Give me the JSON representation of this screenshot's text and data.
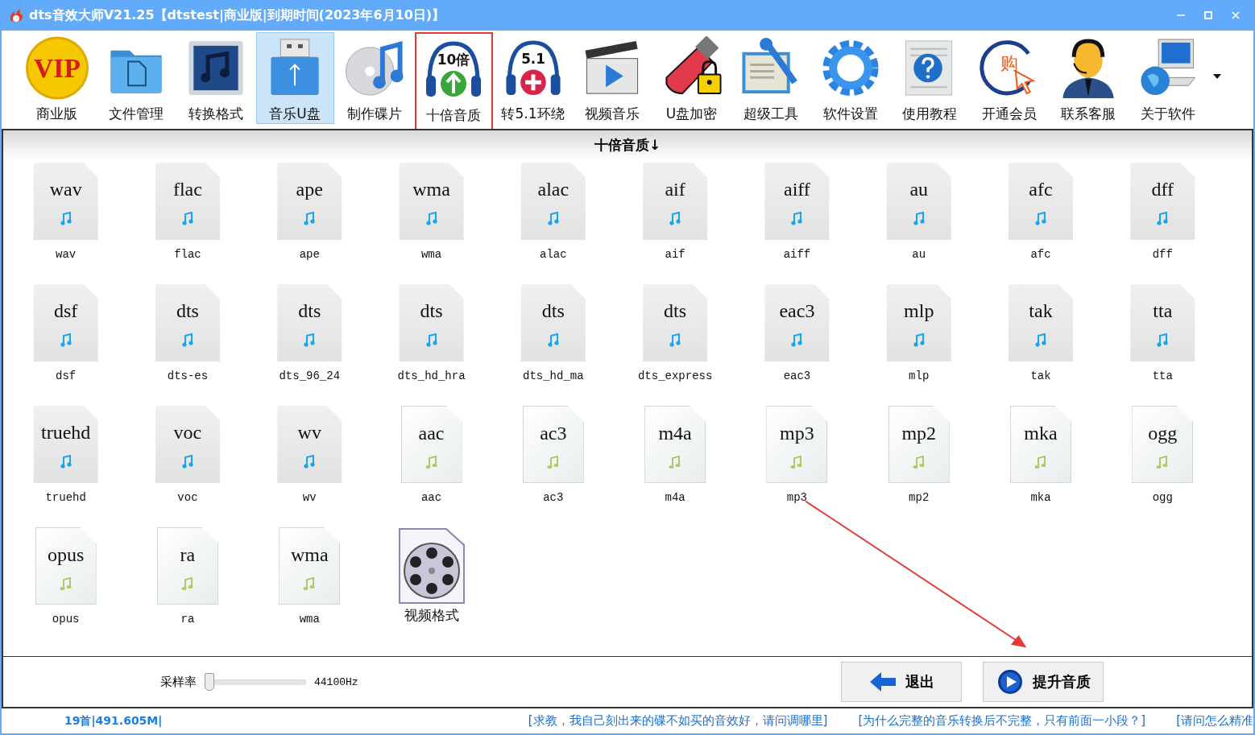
{
  "window": {
    "title": "dts音效大师V21.25【dtstest|商业版|到期时间(2023年6月10日)】"
  },
  "toolbar": [
    {
      "label": "商业版",
      "kind": "vip",
      "icon_text": "VIP",
      "selected": false,
      "outlined": false
    },
    {
      "label": "文件管理",
      "kind": "folder",
      "selected": false,
      "outlined": false
    },
    {
      "label": "转换格式",
      "kind": "note",
      "selected": false,
      "outlined": false
    },
    {
      "label": "音乐U盘",
      "kind": "usb",
      "selected": true,
      "outlined": false
    },
    {
      "label": "制作碟片",
      "kind": "disc",
      "selected": false,
      "outlined": false
    },
    {
      "label": "十倍音质",
      "kind": "headphone_up",
      "icon_text": "10倍",
      "selected": false,
      "outlined": true
    },
    {
      "label": "转5.1环绕",
      "kind": "headphone_plus",
      "icon_text": "5.1",
      "selected": false,
      "outlined": false
    },
    {
      "label": "视频音乐",
      "kind": "clapper",
      "selected": false,
      "outlined": false
    },
    {
      "label": "U盘加密",
      "kind": "lock",
      "selected": false,
      "outlined": false
    },
    {
      "label": "超级工具",
      "kind": "wrench",
      "selected": false,
      "outlined": false
    },
    {
      "label": "软件设置",
      "kind": "gear",
      "selected": false,
      "outlined": false
    },
    {
      "label": "使用教程",
      "kind": "help",
      "selected": false,
      "outlined": false
    },
    {
      "label": "开通会员",
      "kind": "buy",
      "icon_text": "购",
      "selected": false,
      "outlined": false
    },
    {
      "label": "联系客服",
      "kind": "agent",
      "selected": false,
      "outlined": false
    },
    {
      "label": "关于软件",
      "kind": "computer",
      "selected": false,
      "outlined": false
    }
  ],
  "panel": {
    "heading": "十倍音质↓",
    "files": [
      {
        "kind": "blue",
        "ext": "wav",
        "label": "wav"
      },
      {
        "kind": "blue",
        "ext": "flac",
        "label": "flac"
      },
      {
        "kind": "blue",
        "ext": "ape",
        "label": "ape"
      },
      {
        "kind": "blue",
        "ext": "wma",
        "label": "wma"
      },
      {
        "kind": "blue",
        "ext": "alac",
        "label": "alac"
      },
      {
        "kind": "blue",
        "ext": "aif",
        "label": "aif"
      },
      {
        "kind": "blue",
        "ext": "aiff",
        "label": "aiff"
      },
      {
        "kind": "blue",
        "ext": "au",
        "label": "au"
      },
      {
        "kind": "blue",
        "ext": "afc",
        "label": "afc"
      },
      {
        "kind": "blue",
        "ext": "dff",
        "label": "dff"
      },
      {
        "kind": "blue",
        "ext": "dsf",
        "label": "dsf"
      },
      {
        "kind": "blue",
        "ext": "dts",
        "label": "dts-es"
      },
      {
        "kind": "blue",
        "ext": "dts",
        "label": "dts_96_24"
      },
      {
        "kind": "blue",
        "ext": "dts",
        "label": "dts_hd_hra"
      },
      {
        "kind": "blue",
        "ext": "dts",
        "label": "dts_hd_ma"
      },
      {
        "kind": "blue",
        "ext": "dts",
        "label": "dts_express"
      },
      {
        "kind": "blue",
        "ext": "eac3",
        "label": "eac3"
      },
      {
        "kind": "blue",
        "ext": "mlp",
        "label": "mlp"
      },
      {
        "kind": "blue",
        "ext": "tak",
        "label": "tak"
      },
      {
        "kind": "blue",
        "ext": "tta",
        "label": "tta"
      },
      {
        "kind": "blue",
        "ext": "truehd",
        "label": "truehd"
      },
      {
        "kind": "blue",
        "ext": "voc",
        "label": "voc"
      },
      {
        "kind": "blue",
        "ext": "wv",
        "label": "wv"
      },
      {
        "kind": "plain",
        "ext": "aac",
        "label": "aac"
      },
      {
        "kind": "plain",
        "ext": "ac3",
        "label": "ac3"
      },
      {
        "kind": "plain",
        "ext": "m4a",
        "label": "m4a"
      },
      {
        "kind": "plain",
        "ext": "mp3",
        "label": "mp3"
      },
      {
        "kind": "plain",
        "ext": "mp2",
        "label": "mp2"
      },
      {
        "kind": "plain",
        "ext": "mka",
        "label": "mka"
      },
      {
        "kind": "plain",
        "ext": "ogg",
        "label": "ogg"
      },
      {
        "kind": "plain",
        "ext": "opus",
        "label": "opus"
      },
      {
        "kind": "plain",
        "ext": "ra",
        "label": "ra"
      },
      {
        "kind": "plain",
        "ext": "wma",
        "label": "wma"
      },
      {
        "kind": "video",
        "label": "视频格式"
      }
    ]
  },
  "controls": {
    "sample_rate": {
      "label": "采样率",
      "level": 0,
      "reading": "44100Hz"
    },
    "buttons": [
      {
        "kind": "exit",
        "label": "退出"
      },
      {
        "kind": "play",
        "label": "提升音质"
      }
    ]
  },
  "status_bar": {
    "summary": "19首|491.605M|",
    "links": [
      "[求教，我自己刻出来的碟不如买的音效好，请问调哪里]",
      "[为什么完整的音乐转换后不完整，只有前面一小段？]",
      "[请问怎么精准"
    ]
  }
}
